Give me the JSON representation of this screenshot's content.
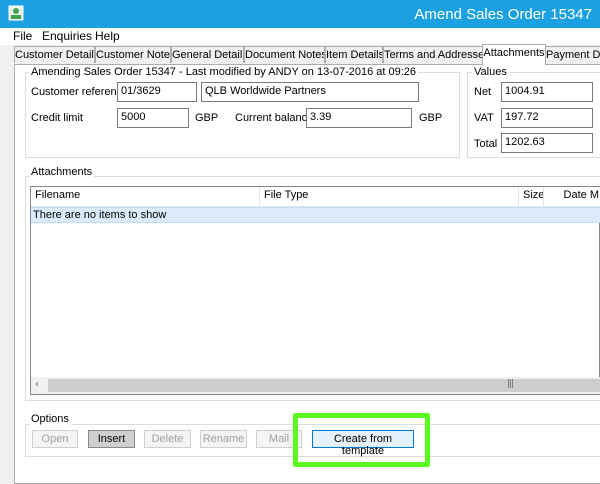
{
  "window": {
    "title": "Amend Sales Order 15347",
    "accent_color": "#1ba1e2",
    "icon": "app-icon"
  },
  "menu": {
    "items": [
      "File",
      "Enquiries",
      "Help"
    ]
  },
  "tabs": {
    "items": [
      "Customer Details",
      "Customer Notes",
      "General Details",
      "Document Notes",
      "Item Details",
      "Terms and Addresses",
      "Attachments",
      "Payment De"
    ],
    "active": "Attachments"
  },
  "header": {
    "group_label": "Amending Sales Order 15347 - Last modified by ANDY on 13-07-2016 at 09:26",
    "customer_reference_label": "Customer reference",
    "customer_reference_value": "01/3629",
    "customer_name_value": "QLB Worldwide Partners",
    "credit_limit_label": "Credit limit",
    "credit_limit_value": "5000",
    "credit_limit_currency": "GBP",
    "current_balance_label": "Current balance",
    "current_balance_value": "3.39",
    "current_balance_currency": "GBP"
  },
  "values": {
    "group_label": "Values",
    "net_label": "Net",
    "net_value": "1004.91",
    "vat_label": "VAT",
    "vat_value": "197.72",
    "total_label": "Total",
    "total_value": "1202.63"
  },
  "attachments": {
    "group_label": "Attachments",
    "columns": [
      "Filename",
      "File Type",
      "Size",
      "Date M"
    ],
    "empty_text": "There are no items to show"
  },
  "options": {
    "group_label": "Options",
    "buttons": {
      "open": "Open",
      "insert": "Insert",
      "delete": "Delete",
      "rename": "Rename",
      "mail": "Mail",
      "create_from_template": "Create from template"
    }
  },
  "highlight_color": "#5bff1f"
}
